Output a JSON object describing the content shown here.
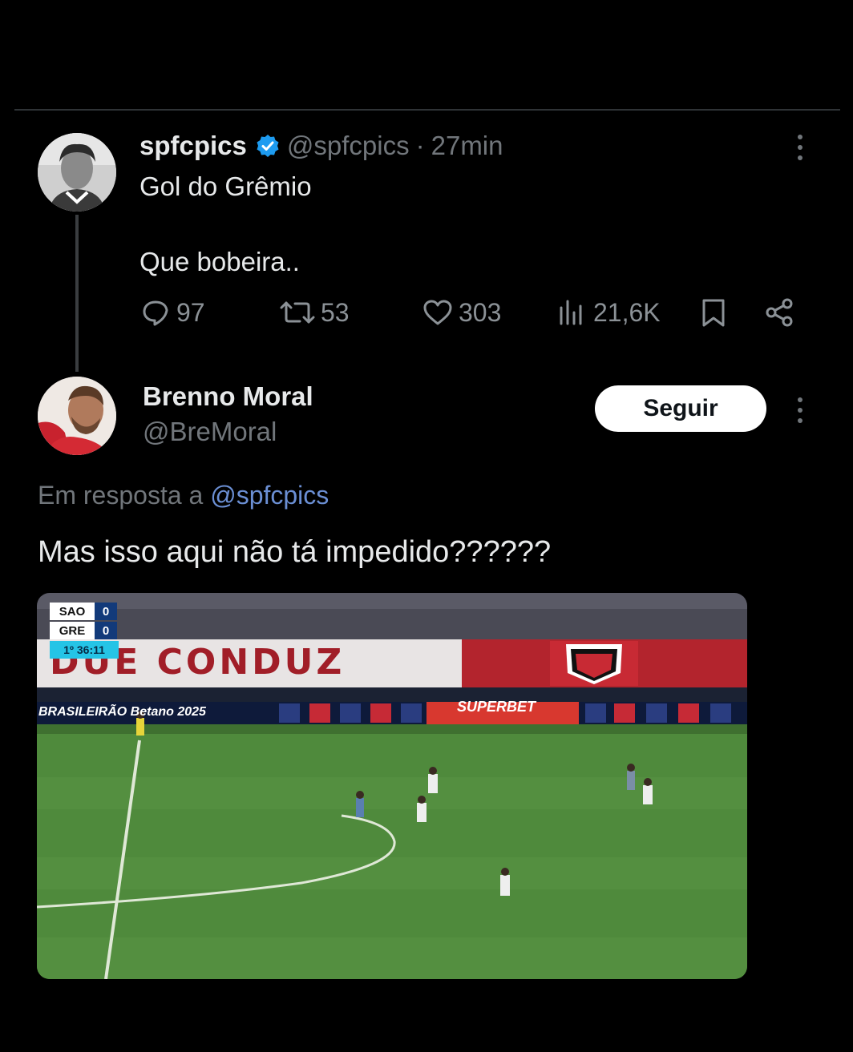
{
  "tweet1": {
    "name": "spfcpics",
    "handle": "@spfcpics",
    "dot": "·",
    "time": "27min",
    "text_line1": "Gol do Grêmio",
    "text_line2": "Que bobeira..",
    "actions": {
      "replies": "97",
      "retweets": "53",
      "likes": "303",
      "views": "21,6K"
    },
    "verified": true,
    "verified_color": "#1d9bf0"
  },
  "tweet2": {
    "name": "Brenno Moral",
    "handle": "@BreMoral",
    "follow_label": "Seguir",
    "reply_prefix": "Em resposta a",
    "reply_mention": "@spfcpics",
    "text": "Mas isso aqui não tá impedido??????"
  },
  "media": {
    "scoreboard": {
      "home": "SAO",
      "home_score": "0",
      "away": "GRE",
      "away_score": "0",
      "clock": "1º 36:11"
    },
    "banner_text": "DUE CONDUZ",
    "league_text": "BRASILEIRÃO Betano 2025",
    "sponsor_text": "SUPERBET"
  },
  "colors": {
    "background": "#000000",
    "text_primary": "#e7e9ea",
    "text_secondary": "#71767b",
    "mention": "#6b8fd4",
    "pitch": "#4f8a3c"
  }
}
